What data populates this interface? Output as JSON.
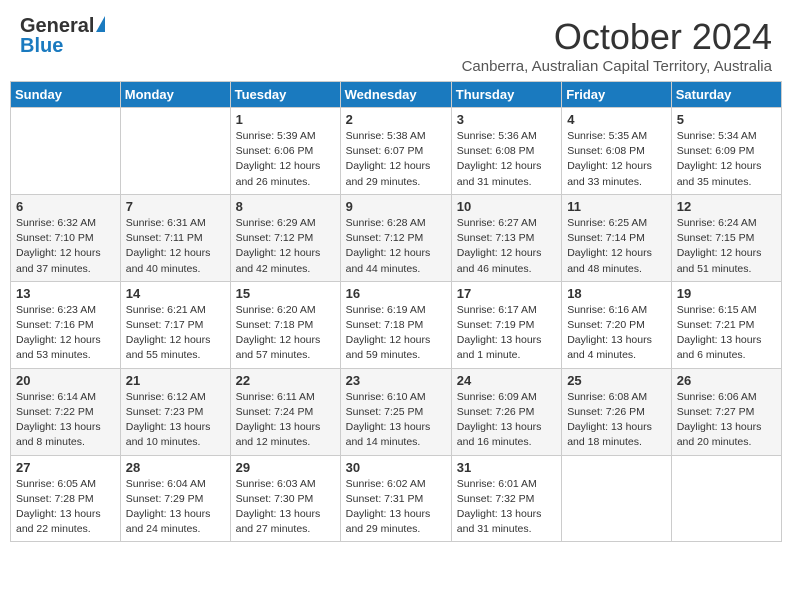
{
  "header": {
    "logo_general": "General",
    "logo_blue": "Blue",
    "month_year": "October 2024",
    "location": "Canberra, Australian Capital Territory, Australia"
  },
  "days_of_week": [
    "Sunday",
    "Monday",
    "Tuesday",
    "Wednesday",
    "Thursday",
    "Friday",
    "Saturday"
  ],
  "weeks": [
    [
      {
        "day": "",
        "info": ""
      },
      {
        "day": "",
        "info": ""
      },
      {
        "day": "1",
        "info": "Sunrise: 5:39 AM\nSunset: 6:06 PM\nDaylight: 12 hours and 26 minutes."
      },
      {
        "day": "2",
        "info": "Sunrise: 5:38 AM\nSunset: 6:07 PM\nDaylight: 12 hours and 29 minutes."
      },
      {
        "day": "3",
        "info": "Sunrise: 5:36 AM\nSunset: 6:08 PM\nDaylight: 12 hours and 31 minutes."
      },
      {
        "day": "4",
        "info": "Sunrise: 5:35 AM\nSunset: 6:08 PM\nDaylight: 12 hours and 33 minutes."
      },
      {
        "day": "5",
        "info": "Sunrise: 5:34 AM\nSunset: 6:09 PM\nDaylight: 12 hours and 35 minutes."
      }
    ],
    [
      {
        "day": "6",
        "info": "Sunrise: 6:32 AM\nSunset: 7:10 PM\nDaylight: 12 hours and 37 minutes."
      },
      {
        "day": "7",
        "info": "Sunrise: 6:31 AM\nSunset: 7:11 PM\nDaylight: 12 hours and 40 minutes."
      },
      {
        "day": "8",
        "info": "Sunrise: 6:29 AM\nSunset: 7:12 PM\nDaylight: 12 hours and 42 minutes."
      },
      {
        "day": "9",
        "info": "Sunrise: 6:28 AM\nSunset: 7:12 PM\nDaylight: 12 hours and 44 minutes."
      },
      {
        "day": "10",
        "info": "Sunrise: 6:27 AM\nSunset: 7:13 PM\nDaylight: 12 hours and 46 minutes."
      },
      {
        "day": "11",
        "info": "Sunrise: 6:25 AM\nSunset: 7:14 PM\nDaylight: 12 hours and 48 minutes."
      },
      {
        "day": "12",
        "info": "Sunrise: 6:24 AM\nSunset: 7:15 PM\nDaylight: 12 hours and 51 minutes."
      }
    ],
    [
      {
        "day": "13",
        "info": "Sunrise: 6:23 AM\nSunset: 7:16 PM\nDaylight: 12 hours and 53 minutes."
      },
      {
        "day": "14",
        "info": "Sunrise: 6:21 AM\nSunset: 7:17 PM\nDaylight: 12 hours and 55 minutes."
      },
      {
        "day": "15",
        "info": "Sunrise: 6:20 AM\nSunset: 7:18 PM\nDaylight: 12 hours and 57 minutes."
      },
      {
        "day": "16",
        "info": "Sunrise: 6:19 AM\nSunset: 7:18 PM\nDaylight: 12 hours and 59 minutes."
      },
      {
        "day": "17",
        "info": "Sunrise: 6:17 AM\nSunset: 7:19 PM\nDaylight: 13 hours and 1 minute."
      },
      {
        "day": "18",
        "info": "Sunrise: 6:16 AM\nSunset: 7:20 PM\nDaylight: 13 hours and 4 minutes."
      },
      {
        "day": "19",
        "info": "Sunrise: 6:15 AM\nSunset: 7:21 PM\nDaylight: 13 hours and 6 minutes."
      }
    ],
    [
      {
        "day": "20",
        "info": "Sunrise: 6:14 AM\nSunset: 7:22 PM\nDaylight: 13 hours and 8 minutes."
      },
      {
        "day": "21",
        "info": "Sunrise: 6:12 AM\nSunset: 7:23 PM\nDaylight: 13 hours and 10 minutes."
      },
      {
        "day": "22",
        "info": "Sunrise: 6:11 AM\nSunset: 7:24 PM\nDaylight: 13 hours and 12 minutes."
      },
      {
        "day": "23",
        "info": "Sunrise: 6:10 AM\nSunset: 7:25 PM\nDaylight: 13 hours and 14 minutes."
      },
      {
        "day": "24",
        "info": "Sunrise: 6:09 AM\nSunset: 7:26 PM\nDaylight: 13 hours and 16 minutes."
      },
      {
        "day": "25",
        "info": "Sunrise: 6:08 AM\nSunset: 7:26 PM\nDaylight: 13 hours and 18 minutes."
      },
      {
        "day": "26",
        "info": "Sunrise: 6:06 AM\nSunset: 7:27 PM\nDaylight: 13 hours and 20 minutes."
      }
    ],
    [
      {
        "day": "27",
        "info": "Sunrise: 6:05 AM\nSunset: 7:28 PM\nDaylight: 13 hours and 22 minutes."
      },
      {
        "day": "28",
        "info": "Sunrise: 6:04 AM\nSunset: 7:29 PM\nDaylight: 13 hours and 24 minutes."
      },
      {
        "day": "29",
        "info": "Sunrise: 6:03 AM\nSunset: 7:30 PM\nDaylight: 13 hours and 27 minutes."
      },
      {
        "day": "30",
        "info": "Sunrise: 6:02 AM\nSunset: 7:31 PM\nDaylight: 13 hours and 29 minutes."
      },
      {
        "day": "31",
        "info": "Sunrise: 6:01 AM\nSunset: 7:32 PM\nDaylight: 13 hours and 31 minutes."
      },
      {
        "day": "",
        "info": ""
      },
      {
        "day": "",
        "info": ""
      }
    ]
  ]
}
